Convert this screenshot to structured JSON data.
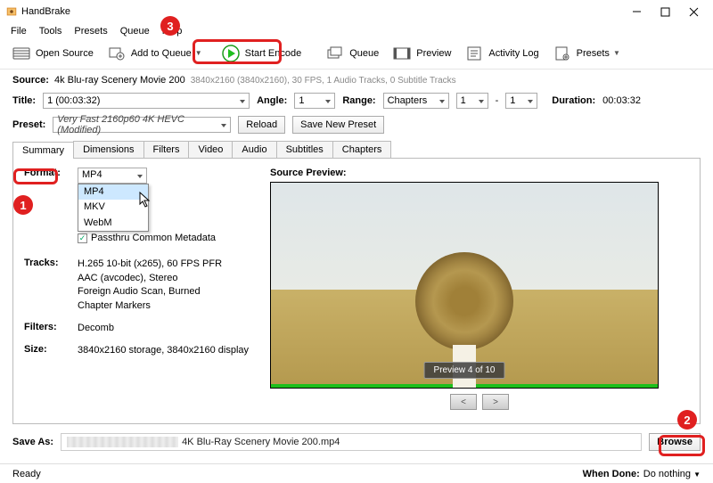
{
  "app": {
    "title": "HandBrake"
  },
  "menu": [
    "File",
    "Tools",
    "Presets",
    "Queue",
    "Help"
  ],
  "toolbar": {
    "open_source": "Open Source",
    "add_to_queue": "Add to Queue",
    "start_encode": "Start Encode",
    "queue": "Queue",
    "preview": "Preview",
    "activity_log": "Activity Log",
    "presets": "Presets"
  },
  "source": {
    "label": "Source:",
    "name": "4k Blu-ray Scenery Movie 200",
    "meta": "3840x2160 (3840x2160), 30 FPS, 1 Audio Tracks, 0 Subtitle Tracks"
  },
  "titlerow": {
    "title_label": "Title:",
    "title_value": "1 (00:03:32)",
    "angle_label": "Angle:",
    "angle_value": "1",
    "range_label": "Range:",
    "range_mode": "Chapters",
    "range_from": "1",
    "range_to": "1",
    "duration_label": "Duration:",
    "duration_value": "00:03:32"
  },
  "preset": {
    "label": "Preset:",
    "value": "Very Fast 2160p60 4K HEVC  (Modified)",
    "reload": "Reload",
    "save_new": "Save New Preset"
  },
  "tabs": [
    "Summary",
    "Dimensions",
    "Filters",
    "Video",
    "Audio",
    "Subtitles",
    "Chapters"
  ],
  "summary": {
    "format_label": "Format:",
    "format_value": "MP4",
    "format_options": [
      "MP4",
      "MKV",
      "WebM"
    ],
    "passthru": "Passthru Common Metadata",
    "tracks_label": "Tracks:",
    "tracks_lines": [
      "H.265 10-bit (x265), 60 FPS PFR",
      "AAC (avcodec), Stereo",
      "Foreign Audio Scan, Burned",
      "Chapter Markers"
    ],
    "filters_label": "Filters:",
    "filters_value": "Decomb",
    "size_label": "Size:",
    "size_value": "3840x2160 storage, 3840x2160 display"
  },
  "preview": {
    "label": "Source Preview:",
    "counter": "Preview 4 of 10"
  },
  "save": {
    "label": "Save As:",
    "filename": "4K Blu-Ray Scenery Movie 200.mp4",
    "browse": "Browse"
  },
  "status": {
    "ready": "Ready",
    "when_done_label": "When Done:",
    "when_done_value": "Do nothing"
  },
  "callouts": {
    "c1": "1",
    "c2": "2",
    "c3": "3"
  }
}
